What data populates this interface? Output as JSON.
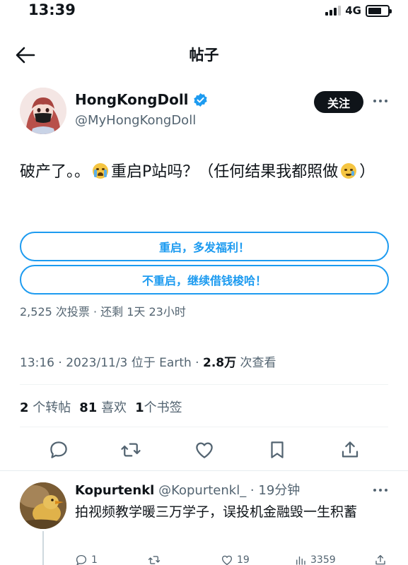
{
  "status_bar": {
    "time": "13:39",
    "network": "4G",
    "battery_level": 0.7
  },
  "header": {
    "title": "帖子",
    "back_icon": "arrow-left-icon"
  },
  "author": {
    "name": "HongKongDoll",
    "handle": "@MyHongKongDoll",
    "verified": true,
    "follow_label": "关注",
    "more_icon": "more-horizontal-icon"
  },
  "tweet": {
    "text_part1": "破产了。。",
    "emoji1": "loudly-crying-face-emoji",
    "text_part2": "重启P站吗？（任何结果我都照做",
    "emoji2": "face-holding-back-tears-emoji",
    "text_part3": "）"
  },
  "poll": {
    "options": [
      {
        "label": "重启，多发福利！"
      },
      {
        "label": "不重启，继续借钱梭哈！"
      }
    ],
    "meta": "2,525 次投票 · 还剩 1天 23小时"
  },
  "timestamp": {
    "prefix": "13:16 · 2023/11/3 位于 Earth · ",
    "views_count": "2.8万",
    "views_label": " 次查看"
  },
  "stats": [
    {
      "count": "2",
      "label": "个转帖"
    },
    {
      "count": "81",
      "label": "喜欢"
    },
    {
      "count": "1",
      "label": "个书签"
    }
  ],
  "actions": [
    "reply-icon",
    "retweet-icon",
    "like-icon",
    "bookmark-icon",
    "share-icon"
  ],
  "reply": {
    "name": "Kopurtenkl",
    "handle_time": "@Kopurtenkl_ · 19分钟",
    "text": "拍视频教学暖三万学子，误投机金融毁一生积蓄",
    "stats": {
      "replies": "1",
      "retweets": "",
      "likes": "19",
      "views": "3359"
    }
  },
  "colors": {
    "accent": "#1d9bf0",
    "text": "#0f1419",
    "secondary": "#536471"
  }
}
